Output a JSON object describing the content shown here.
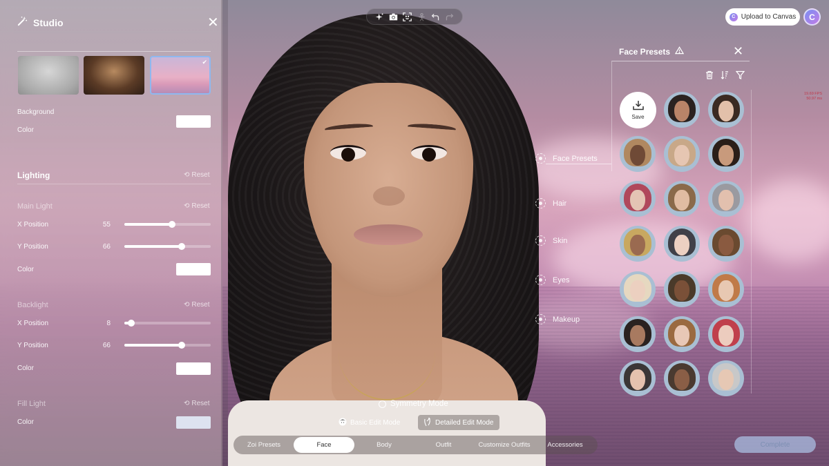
{
  "studio": {
    "title": "Studio",
    "icon": "magic-wand-icon",
    "backgrounds": [
      {
        "name": "Gray studio",
        "selected": false
      },
      {
        "name": "Cozy room",
        "selected": false
      },
      {
        "name": "Pink clouds",
        "selected": true
      }
    ],
    "background_label": "Background",
    "background_color_label": "Color",
    "background_color": "#ffffff",
    "lighting": {
      "title": "Lighting",
      "reset_label": "Reset",
      "main_light": {
        "title": "Main Light",
        "reset_label": "Reset",
        "x_label": "X Position",
        "x_value": "55",
        "y_label": "Y Position",
        "y_value": "66",
        "color_label": "Color",
        "color": "#ffffff"
      },
      "backlight": {
        "title": "Backlight",
        "reset_label": "Reset",
        "x_label": "X Position",
        "x_value": "8",
        "y_label": "Y Position",
        "y_value": "66",
        "color_label": "Color",
        "color": "#ffffff"
      },
      "fill_light": {
        "title": "Fill Light",
        "reset_label": "Reset",
        "color_label": "Color",
        "color": "#dde2f0"
      }
    }
  },
  "slider_ranges": {
    "min": 0,
    "max": 100
  },
  "toolbar": {
    "icons": [
      "sparkle-icon",
      "camera-icon",
      "face-scan-icon",
      "body-pose-icon",
      "undo-icon",
      "redo-icon"
    ]
  },
  "top_right": {
    "upload_label": "Upload to Canvas",
    "avatar_letter": "C"
  },
  "perf": {
    "fps": "19.69 FPS",
    "ms": "50.97 ms"
  },
  "categories": [
    {
      "label": "Face Presets",
      "active": true
    },
    {
      "label": "Hair",
      "active": false
    },
    {
      "label": "Skin",
      "active": false
    },
    {
      "label": "Eyes",
      "active": false
    },
    {
      "label": "Makeup",
      "active": false
    }
  ],
  "face_presets": {
    "title": "Face Presets",
    "save_label": "Save",
    "tools": [
      "trash-icon",
      "sort-icon",
      "filter-icon"
    ],
    "presets": [
      {
        "hair": "#2a2220",
        "skin": "#b98468"
      },
      {
        "hair": "#3a2a22",
        "skin": "#e2c0aa"
      },
      {
        "hair": "#b08860",
        "skin": "#6f4a36"
      },
      {
        "hair": "#c8a888",
        "skin": "#e6c6b2"
      },
      {
        "hair": "#2a1e18",
        "skin": "#c89a7c"
      },
      {
        "hair": "#b0485c",
        "skin": "#e4c4b4"
      },
      {
        "hair": "#8a6a4a",
        "skin": "#e0bca2"
      },
      {
        "hair": "#9a9aa0",
        "skin": "#e2c0ae"
      },
      {
        "hair": "#c8a860",
        "skin": "#9a6a50"
      },
      {
        "hair": "#404048",
        "skin": "#ecd0c2"
      },
      {
        "hair": "#6a4a30",
        "skin": "#8a5a40"
      },
      {
        "hair": "#e6d8c0",
        "skin": "#ecd0c0"
      },
      {
        "hair": "#4a3a2a",
        "skin": "#7a5038"
      },
      {
        "hair": "#c07a48",
        "skin": "#e8c8b2"
      },
      {
        "hair": "#2a2220",
        "skin": "#a87a60"
      },
      {
        "hair": "#9a6a40",
        "skin": "#e8c8b6"
      },
      {
        "hair": "#c0404c",
        "skin": "#ecccbe"
      },
      {
        "hair": "#3a3636",
        "skin": "#e4c2ae"
      },
      {
        "hair": "#4a3a30",
        "skin": "#8a5e46"
      },
      {
        "hair": "#c8c8c8",
        "skin": "#e6c8b4"
      }
    ]
  },
  "edit": {
    "symmetry_label": "Symmetry Mode",
    "basic_label": "Basic Edit Mode",
    "detailed_label": "Detailed Edit Mode"
  },
  "tabs": [
    {
      "label": "Zoi Presets",
      "active": false
    },
    {
      "label": "Face",
      "active": true
    },
    {
      "label": "Body",
      "active": false
    },
    {
      "label": "Outfit",
      "active": false
    },
    {
      "label": "Customize Outfits",
      "active": false
    },
    {
      "label": "Accessories",
      "active": false
    }
  ],
  "complete_label": "Complete"
}
